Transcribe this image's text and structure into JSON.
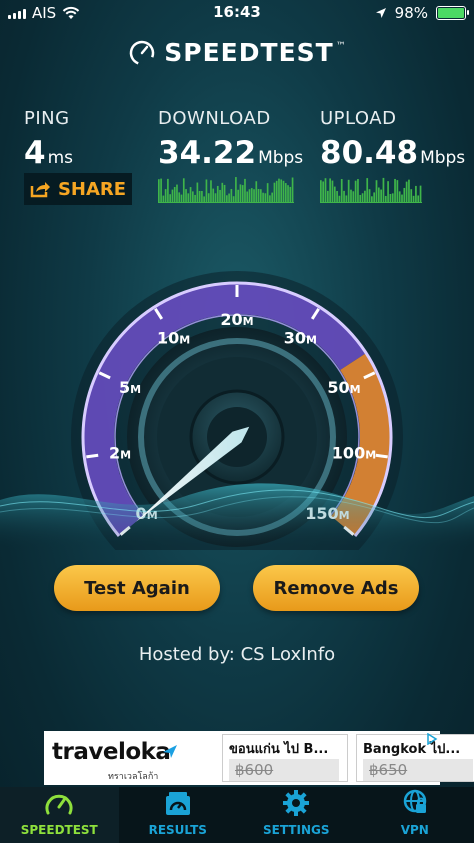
{
  "status_bar": {
    "carrier": "AIS",
    "time": "16:43",
    "battery": "98%"
  },
  "app": {
    "logo_text": "SPEEDTEST",
    "logo_mark": "™"
  },
  "stats": {
    "ping": {
      "label": "PING",
      "value": "4",
      "unit": "ms"
    },
    "download": {
      "label": "DOWNLOAD",
      "value": "34.22",
      "unit": "Mbps"
    },
    "upload": {
      "label": "UPLOAD",
      "value": "80.48",
      "unit": "Mbps"
    }
  },
  "share_label": "SHARE",
  "gauge": {
    "ticks": [
      {
        "value": "0",
        "unit": "M"
      },
      {
        "value": "2",
        "unit": "M"
      },
      {
        "value": "5",
        "unit": "M"
      },
      {
        "value": "10",
        "unit": "M"
      },
      {
        "value": "20",
        "unit": "M"
      },
      {
        "value": "30",
        "unit": "M"
      },
      {
        "value": "50",
        "unit": "M"
      },
      {
        "value": "100",
        "unit": "M"
      },
      {
        "value": "150",
        "unit": "M"
      }
    ],
    "needle_fraction": 0.0,
    "colors": {
      "arc_purple": "#7a5bd6",
      "arc_orange": "#f29a3c",
      "needle": "#ffffff"
    }
  },
  "buttons": {
    "test_again": "Test Again",
    "remove_ads": "Remove Ads"
  },
  "hosted_by": "Hosted by: CS LoxInfo",
  "ad": {
    "brand": "traveloka",
    "brand_sub": "ทราเวลโลก้า",
    "cards": [
      {
        "title": "ขอนแก่น ไป B...",
        "price": "฿600"
      },
      {
        "title": "Bangkok ไป...",
        "price": "฿650"
      }
    ]
  },
  "tabs": [
    {
      "label": "SPEEDTEST",
      "icon": "speedometer-icon",
      "active": true
    },
    {
      "label": "RESULTS",
      "icon": "results-icon",
      "active": false
    },
    {
      "label": "SETTINGS",
      "icon": "gear-icon",
      "active": false
    },
    {
      "label": "VPN",
      "icon": "vpn-globe-icon",
      "active": false
    }
  ],
  "accent_colors": {
    "share": "#f6a623",
    "tab_active": "#8ee03c",
    "tab_inactive": "#1aa3d6",
    "graph": "#3fb54a"
  }
}
